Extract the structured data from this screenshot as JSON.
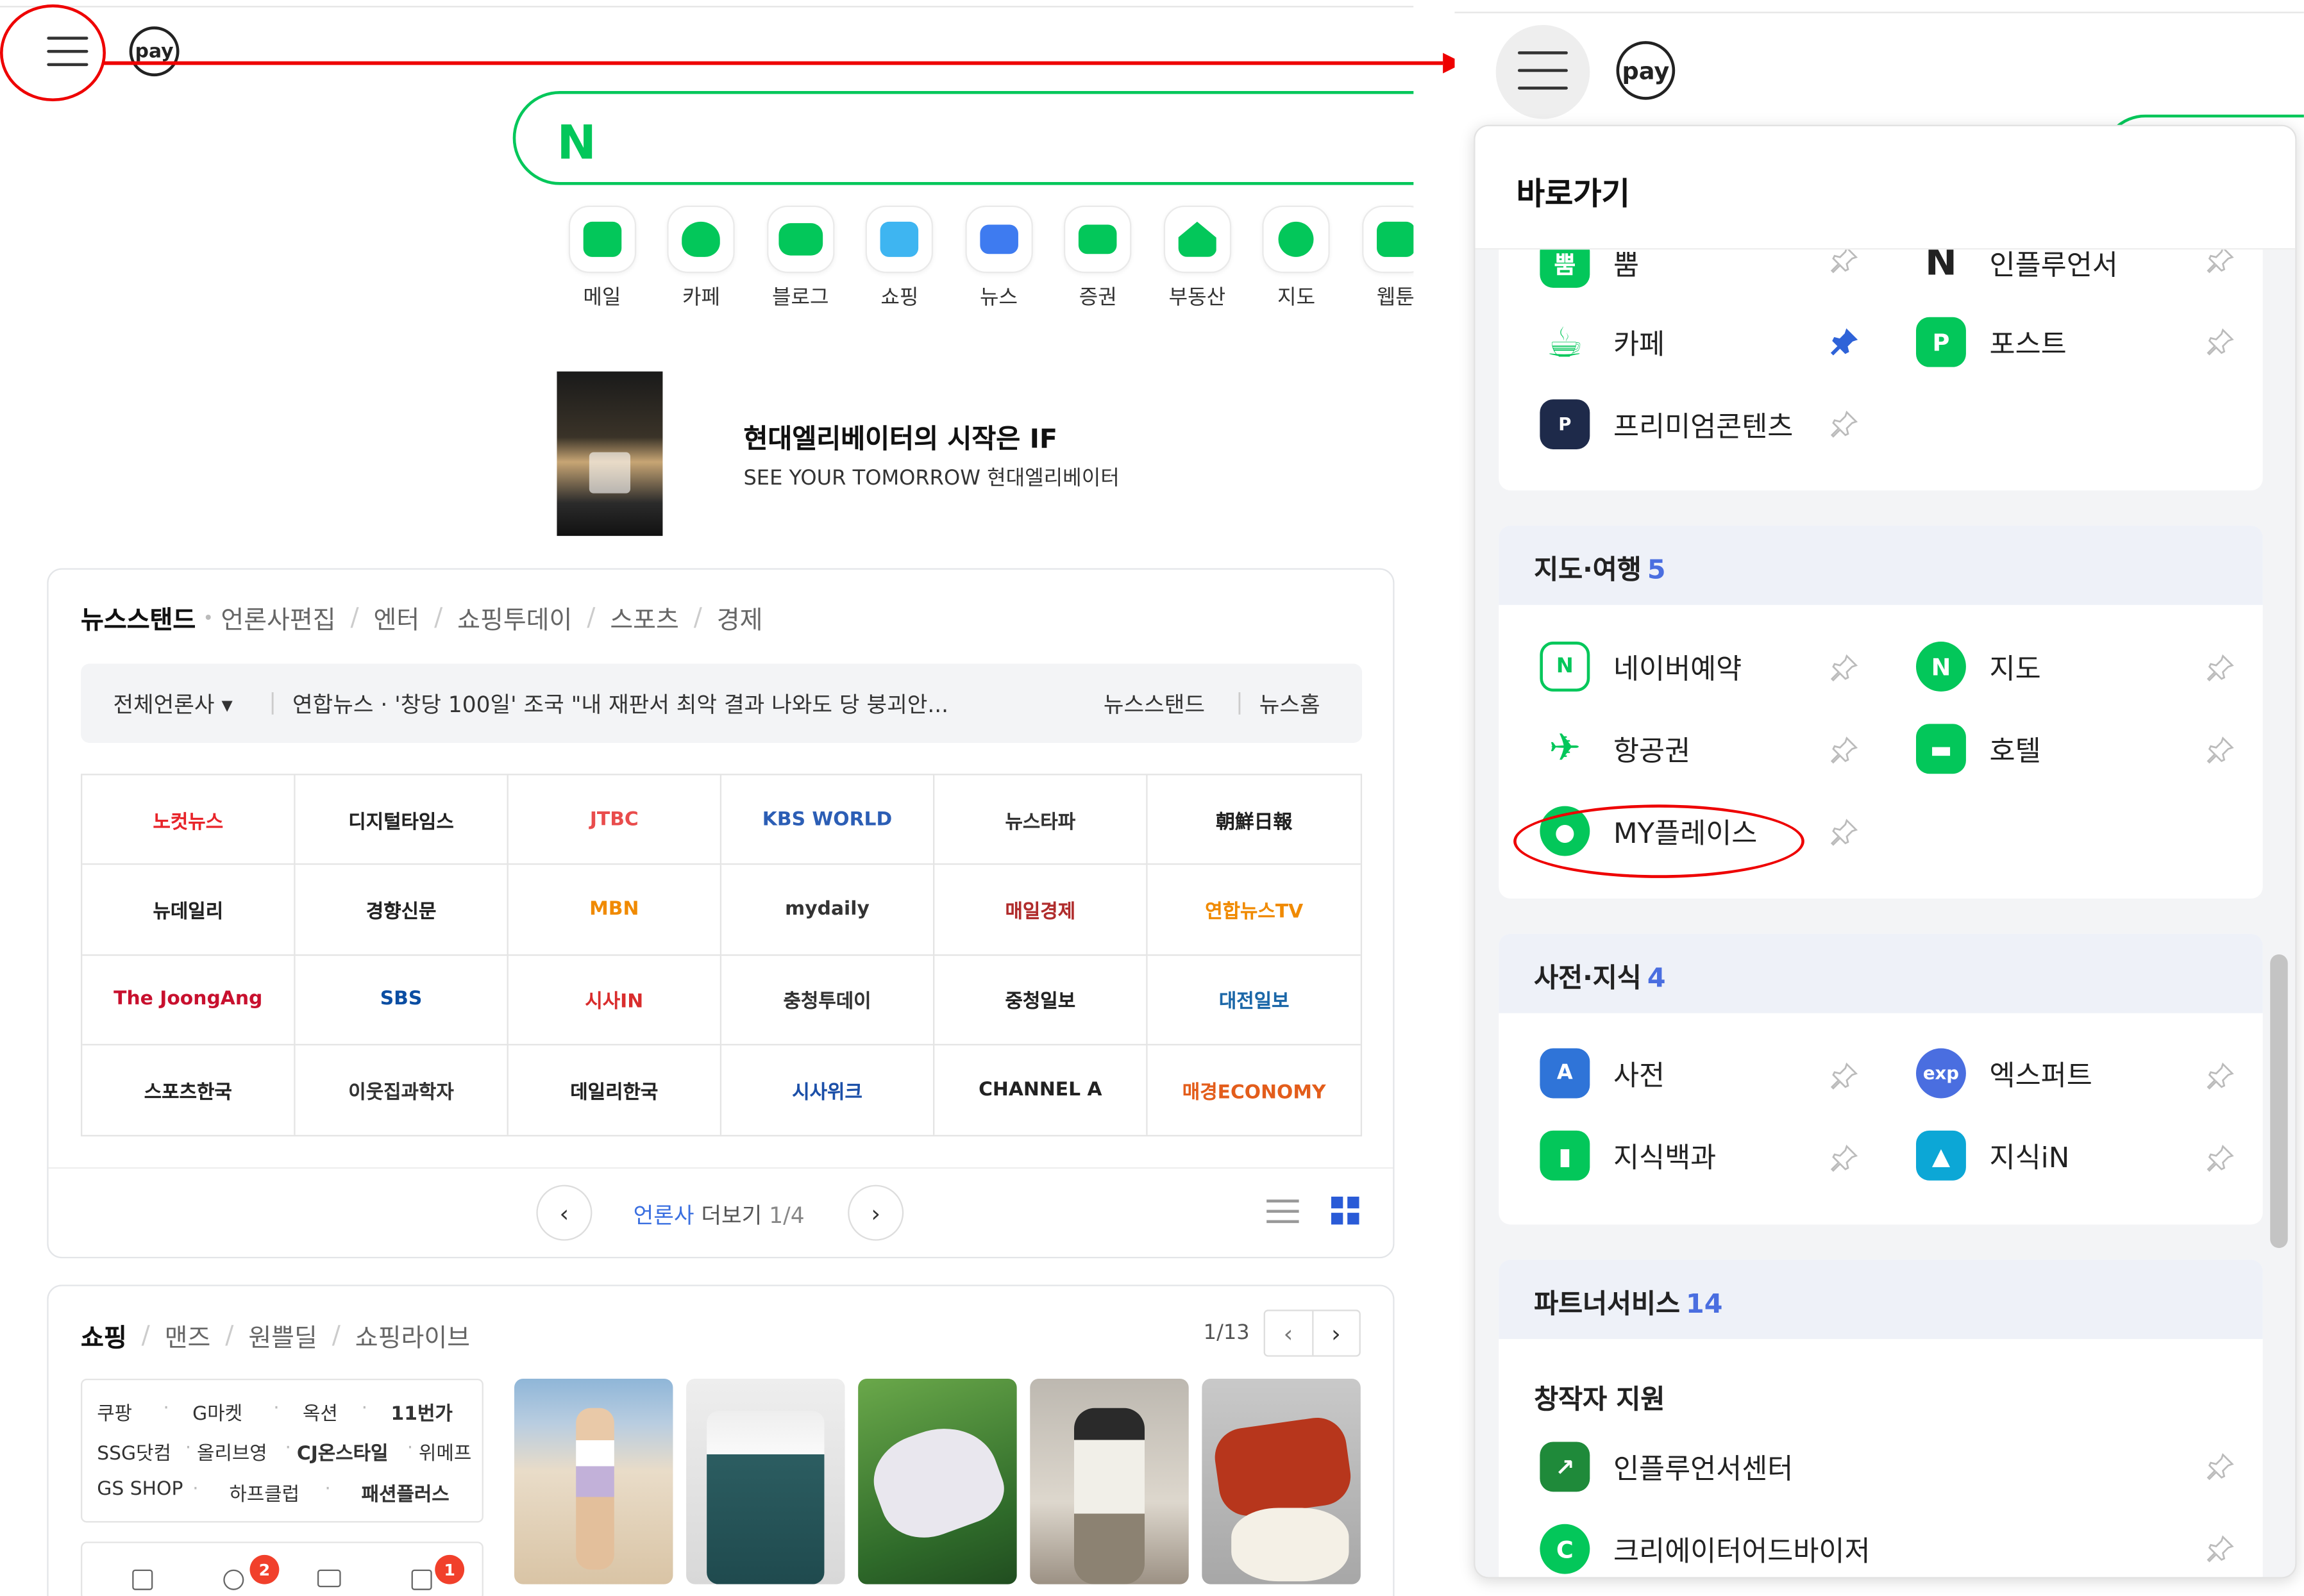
{
  "left_page": {
    "pay_label": "pay",
    "search_logo": "N",
    "services": [
      "메일",
      "카페",
      "블로그",
      "쇼핑",
      "뉴스",
      "증권",
      "부동산",
      "지도",
      "웹툰"
    ],
    "service_colors": [
      "#03c75a",
      "#03c75a",
      "#03c75a",
      "#24a9f2",
      "#3e7bf0",
      "#03c75a",
      "#03c75a",
      "#03c75a",
      "#03c75a"
    ],
    "ad": {
      "title": "현대엘리베이터의 시작은 IF",
      "subtitle": "SEE YOUR TOMORROW 현대엘리베이터"
    },
    "news_tabs": [
      "뉴스스탠드",
      "언론사편집",
      "엔터",
      "쇼핑투데이",
      "스포츠",
      "경제"
    ],
    "news_bar": {
      "filter": "전체언론사 ▾",
      "headline": "연합뉴스 · '창당 100일' 조국 \"내 재판서 최악 결과 나와도 당 붕괴안...",
      "link1": "뉴스스탠드",
      "link2": "뉴스홈"
    },
    "press": [
      "노컷뉴스",
      "디지털타임스",
      "JTBC",
      "KBS WORLD",
      "뉴스타파",
      "朝鮮日報",
      "뉴데일리",
      "경향신문",
      "MBN",
      "mydaily",
      "매일경제",
      "연합뉴스TV",
      "The JoongAng",
      "SBS",
      "시사IN",
      "충청투데이",
      "중청일보",
      "대전일보",
      "스포츠한국",
      "이웃집과학자",
      "데일리한국",
      "시사위크",
      "CHANNEL A",
      "매경ECONOMY"
    ],
    "press_colors": [
      "#e8242a",
      "#222",
      "#e94c4c",
      "#2c5eb5",
      "#333",
      "#222",
      "#222",
      "#222",
      "#f08a00",
      "#333",
      "#b02c2c",
      "#f08a00",
      "#c8102e",
      "#0a4da2",
      "#d92d2d",
      "#333",
      "#222",
      "#1b67a8",
      "#222",
      "#333",
      "#222",
      "#1b4fa8",
      "#222",
      "#e35d1b"
    ],
    "pager": {
      "label": "언론사",
      "more": "더보기",
      "page": "1/4"
    },
    "shop_tabs": [
      "쇼핑",
      "맨즈",
      "원쁠딜",
      "쇼핑라이브"
    ],
    "shop_page": "1/13",
    "shop_list": [
      [
        "쿠팡",
        "G마켓",
        "옥션",
        "11번가"
      ],
      [
        "SSG닷컴",
        "올리브영",
        "CJ온스타일",
        "위메프"
      ],
      [
        "GS SHOP",
        "하프클럽",
        "패션플러스"
      ]
    ],
    "badges": [
      "2",
      "1"
    ]
  },
  "right_page": {
    "pay_label": "pay",
    "panel_title": "바로가기",
    "top_items": [
      {
        "label": "뿜",
        "color": "#03c75a",
        "glyph": "뿜"
      },
      {
        "label": "인플루언서",
        "color": "#ffffff",
        "glyph": "N"
      },
      {
        "label": "카페",
        "color": "#03c75a",
        "glyph": "☕"
      },
      {
        "label": "포스트",
        "color": "#03c75a",
        "glyph": "P"
      },
      {
        "label": "프리미엄콘텐츠",
        "color": "#1e2a4a",
        "glyph": "P"
      }
    ],
    "sections": [
      {
        "title": "지도·여행",
        "count": "5",
        "items": [
          "네이버예약",
          "지도",
          "항공권",
          "호텔",
          "MY플레이스"
        ]
      },
      {
        "title": "사전·지식",
        "count": "4",
        "items": [
          "사전",
          "엑스퍼트",
          "지식백과",
          "지식iN"
        ]
      },
      {
        "title": "파트너서비스",
        "count": "14",
        "subtitle": "창작자 지원",
        "items": [
          "인플루언서센터",
          "크리에이터어드바이저"
        ]
      }
    ],
    "accent": "#4a6ee0"
  }
}
